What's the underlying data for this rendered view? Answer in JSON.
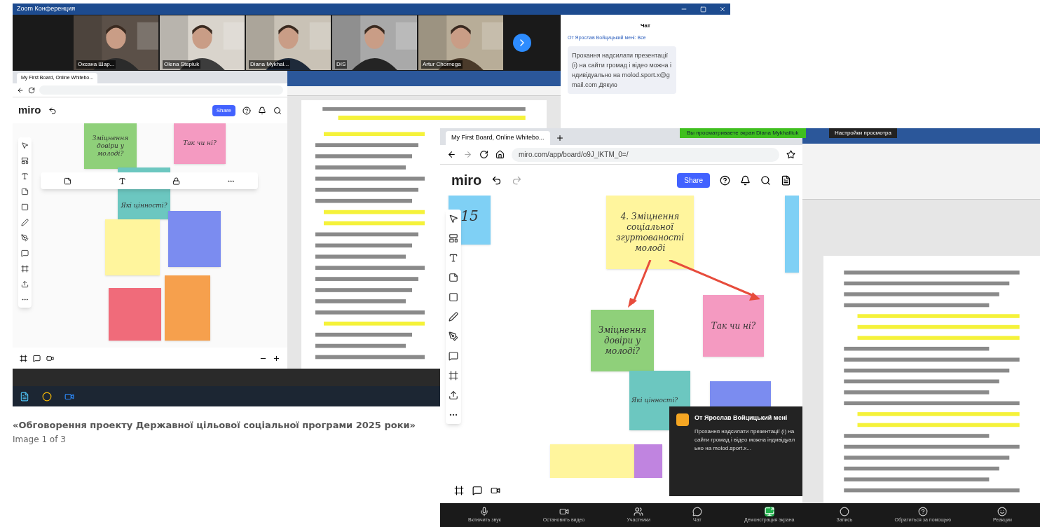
{
  "gallery_image": {
    "back_screenshot": {
      "window_title": "Zoom Конференция",
      "participants": [
        {
          "name": "Оксана Шар..."
        },
        {
          "name": "Olena Stepiuk"
        },
        {
          "name": "Diana Mykhal..."
        },
        {
          "name": "DIS"
        },
        {
          "name": "Artur Chornega"
        }
      ],
      "chat": {
        "title": "Чат",
        "sender": "От Ярослав Войцицький мені: Все",
        "message": "Прохання надсилати презентації (і) на сайти громад і відео можна індивідуально на molod.sport.x@gmail.com Дякую"
      },
      "miro": {
        "tab": "My First Board, Online Whitebo...",
        "logo": "miro",
        "share": "Share",
        "stickies": [
          {
            "text": "Зміцнення довіри у молоді?",
            "color": "#8fd07a"
          },
          {
            "text": "Так чи ні?",
            "color": "#f49ac1"
          },
          {
            "text": "Які цінності?",
            "color": "#6cc7c0"
          },
          {
            "color": "#fff59d"
          },
          {
            "color": "#7b8cf0"
          },
          {
            "color": "#f6a04d"
          },
          {
            "color": "#f06b7a"
          }
        ]
      }
    },
    "front_screenshot": {
      "tab": "My First Board, Online Whitebo...",
      "url": "miro.com/app/board/o9J_lKTM_0=/",
      "screen_share_banner": "Вы просматриваете экран Diana Mykhailiuk",
      "view_options": "Настройки просмотра",
      "miro": {
        "logo": "miro",
        "share": "Share",
        "stickies": [
          {
            "text": "15",
            "color": "#7fd0f5"
          },
          {
            "text": "4. Зміцнення соціальної згуртованості молоді",
            "color": "#fff59d"
          },
          {
            "text": "Так чи ні?",
            "color": "#f49ac1"
          },
          {
            "text": "Зміцнення довіри у молоді?",
            "color": "#8fd07a"
          },
          {
            "text": "Які цінності?",
            "color": "#6cc7c0"
          },
          {
            "color": "#7b8cf0"
          },
          {
            "color": "#fff59d"
          },
          {
            "color": "#c084e0"
          },
          {
            "color": "#7fd0f5"
          }
        ]
      },
      "notification": {
        "sender": "От Ярослав Войцицький мені",
        "message": "Прохання надсилати презентації (і) на сайти громад і відео можна індивідуально на molod.sport.x..."
      },
      "zoom_controls": [
        {
          "label": "Включить звук",
          "kind": "mic"
        },
        {
          "label": "Остановить видео",
          "kind": "video"
        },
        {
          "label": "Участники",
          "kind": "people"
        },
        {
          "label": "Чат",
          "kind": "chat"
        },
        {
          "label": "Демонстрация экрана",
          "kind": "share"
        },
        {
          "label": "Запись",
          "kind": "record"
        },
        {
          "label": "Обратиться за помощью",
          "kind": "help"
        },
        {
          "label": "Реакции",
          "kind": "react"
        }
      ]
    },
    "caption": {
      "title": "«Обговорення проекту Державної цільової соціальної програми 2025 роки»",
      "counter": "Image 1 of 3"
    }
  }
}
